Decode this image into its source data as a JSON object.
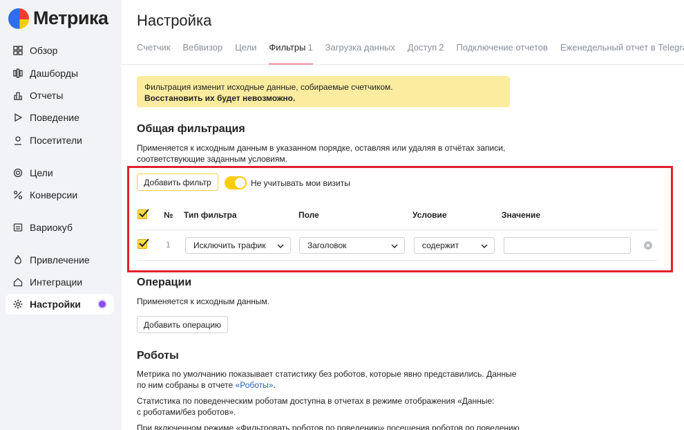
{
  "app": {
    "name": "Метрика"
  },
  "sidebar": {
    "items": [
      {
        "label": "Обзор",
        "icon": "grid-icon"
      },
      {
        "label": "Дашборды",
        "icon": "dashboards-icon"
      },
      {
        "label": "Отчеты",
        "icon": "bar-chart-icon"
      },
      {
        "label": "Поведение",
        "icon": "play-icon"
      },
      {
        "label": "Посетители",
        "icon": "person-icon"
      },
      {
        "label": "Цели",
        "icon": "target-icon"
      },
      {
        "label": "Конверсии",
        "icon": "percent-icon"
      },
      {
        "label": "Вариокуб",
        "icon": "cube-icon"
      },
      {
        "label": "Привлечение",
        "icon": "flame-icon"
      },
      {
        "label": "Интеграции",
        "icon": "home-icon"
      },
      {
        "label": "Настройки",
        "icon": "gear-icon",
        "active": true
      }
    ]
  },
  "page": {
    "title": "Настройка"
  },
  "tabs": [
    {
      "label": "Счетчик",
      "count": ""
    },
    {
      "label": "Вебвизор",
      "count": ""
    },
    {
      "label": "Цели",
      "count": ""
    },
    {
      "label": "Фильтры",
      "count": "1",
      "active": true
    },
    {
      "label": "Загрузка данных",
      "count": ""
    },
    {
      "label": "Доступ",
      "count": "2"
    },
    {
      "label": "Подключение отчетов",
      "count": ""
    },
    {
      "label": "Еженедельный отчет в Telegram",
      "count": ""
    }
  ],
  "warning": {
    "line1": "Фильтрация изменит исходные данные, собираемые счетчиком.",
    "line2": "Восстановить их будет невозможно."
  },
  "general_filtering": {
    "title": "Общая фильтрация",
    "description_line1": "Применяется к исходным данным в указанном порядке, оставляя или удаляя в отчётах записи,",
    "description_line2": "соответствующие заданным условиям.",
    "add_filter_button": "Добавить фильтр",
    "toggle_label": "Не учитывать мои визиты",
    "toggle_on": true,
    "table": {
      "headers": {
        "number": "№",
        "type": "Тип фильтра",
        "field": "Поле",
        "condition": "Условие",
        "value": "Значение"
      },
      "rows": [
        {
          "number": "1",
          "type": "Исключить трафик",
          "field": "Заголовок",
          "condition": "содержит",
          "value": "",
          "checked": true
        }
      ]
    }
  },
  "operations": {
    "title": "Операции",
    "description": "Применяется к исходным данным.",
    "add_button": "Добавить операцию"
  },
  "robots": {
    "title": "Роботы",
    "p1_line1": "Метрика по умолчанию показывает статистику без роботов, которые явно представились. Данные",
    "p1_line2_prefix": "по ним собраны в отчете ",
    "p1_link": "«Роботы»",
    "p1_line2_suffix": ".",
    "p2_line1": "Статистика по поведенческим роботам доступна в отчетах в режиме отображения «Данные:",
    "p2_line2": "с роботами/без роботов».",
    "p3_line1": "При включенном режиме «Фильтровать роботов по поведению» посещения роботов по поведению"
  },
  "colors": {
    "accent_yellow": "#ffcc00",
    "warning_bg": "#fcec9f",
    "highlight_red": "#e0222a",
    "active_tab_underline": "#f0424a",
    "link_blue": "#1f5fbf"
  }
}
